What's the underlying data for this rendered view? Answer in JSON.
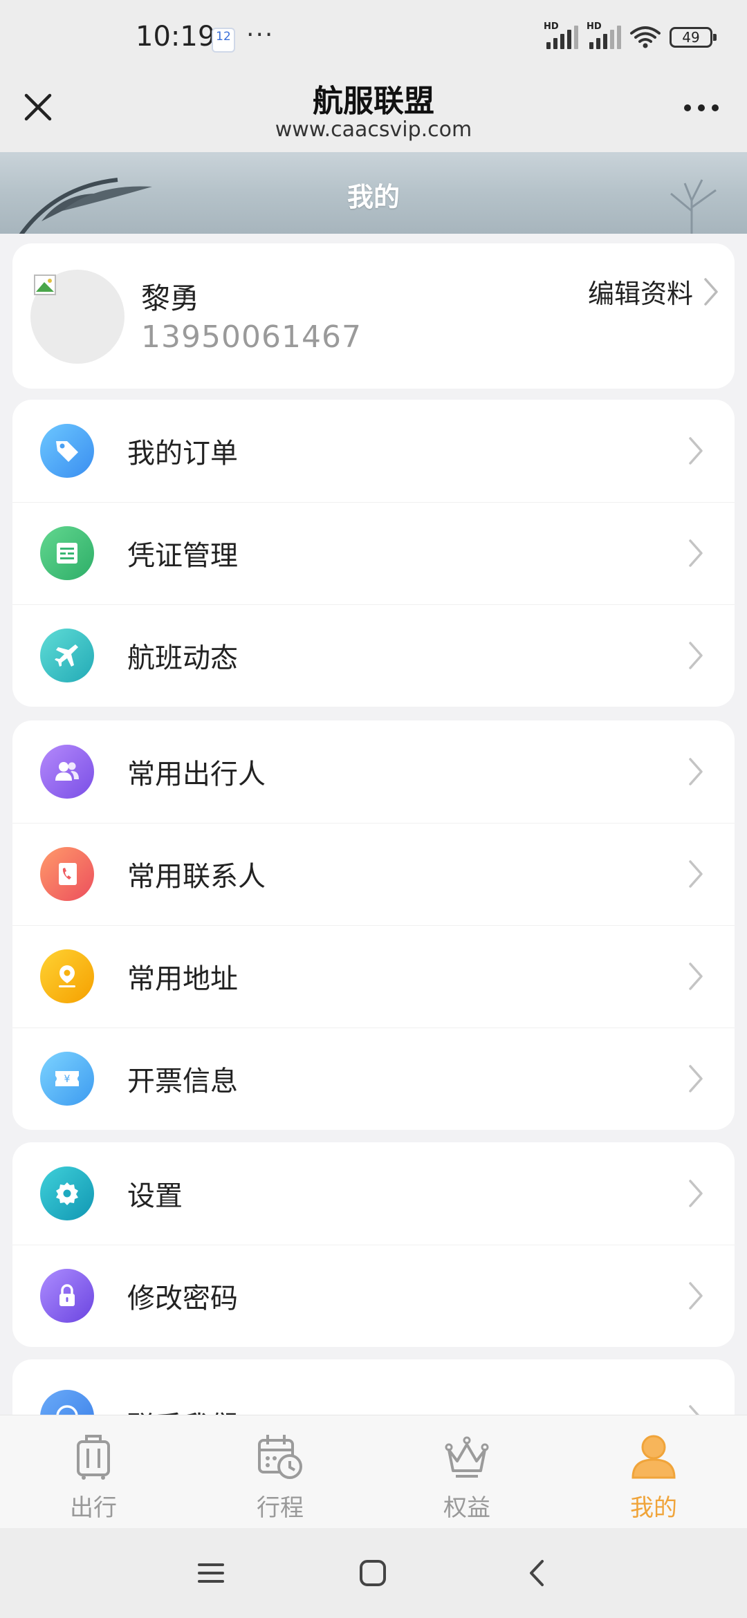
{
  "status_bar": {
    "time": "10:19",
    "calendar_day": "12",
    "more": "···",
    "battery": "49"
  },
  "header": {
    "title": "航服联盟",
    "url": "www.caacsvip.com"
  },
  "banner": {
    "title": "我的"
  },
  "profile": {
    "name": "黎勇",
    "phone": "13950061467",
    "edit_label": "编辑资料"
  },
  "menu_groups": [
    [
      {
        "label": "我的订单",
        "icon": "tag-icon",
        "color": "#49a9f5"
      },
      {
        "label": "凭证管理",
        "icon": "voucher-icon",
        "color": "#3fc27c"
      },
      {
        "label": "航班动态",
        "icon": "airplane-icon",
        "color": "#35c4c2"
      }
    ],
    [
      {
        "label": "常用出行人",
        "icon": "people-icon",
        "color": "#9a6af1"
      },
      {
        "label": "常用联系人",
        "icon": "phone-book-icon",
        "color": "#f3675e"
      },
      {
        "label": "常用地址",
        "icon": "location-icon",
        "color": "#f9b217"
      },
      {
        "label": "开票信息",
        "icon": "ticket-icon",
        "color": "#55b6f5"
      }
    ],
    [
      {
        "label": "设置",
        "icon": "gear-icon",
        "color": "#1fb0c2"
      },
      {
        "label": "修改密码",
        "icon": "lock-icon",
        "color": "#8f69ef"
      }
    ],
    [
      {
        "label": "联系我们",
        "icon": "headset-icon",
        "color": "#4e8ff1"
      }
    ]
  ],
  "tabs": [
    {
      "label": "出行",
      "icon": "luggage-icon",
      "active": false
    },
    {
      "label": "行程",
      "icon": "calendar-clock-icon",
      "active": false
    },
    {
      "label": "权益",
      "icon": "crown-icon",
      "active": false
    },
    {
      "label": "我的",
      "icon": "person-icon",
      "active": true
    }
  ],
  "colors": {
    "accent": "#f0a43a",
    "tab_inactive": "#999999"
  }
}
